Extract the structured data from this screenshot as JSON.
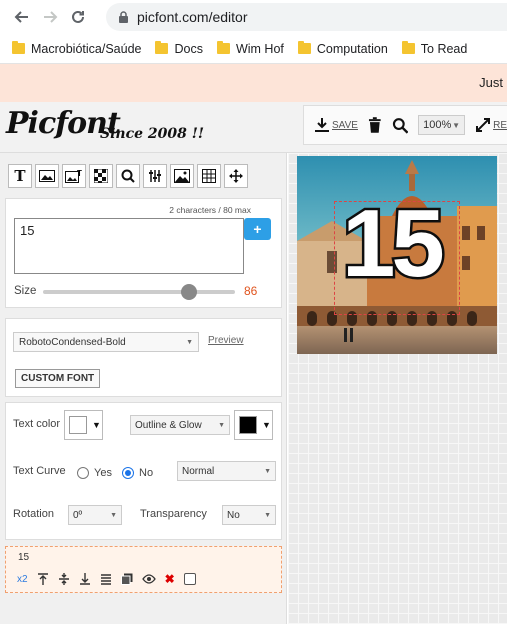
{
  "browser": {
    "url": "picfont.com/editor",
    "bookmarks": [
      "Macrobiótica/Saúde",
      "Docs",
      "Wim Hof",
      "Computation",
      "To Read"
    ]
  },
  "banner": {
    "text": "Just"
  },
  "app": {
    "logo": "Picfont",
    "since": "Since 2008 !!",
    "toolbar": {
      "save_label": "SAVE",
      "zoom": "100%",
      "re_label": "RE"
    }
  },
  "text_panel": {
    "char_count": "2 characters / 80 max",
    "text_value": "15",
    "plus_label": "+",
    "size_label": "Size",
    "size_value": "86",
    "size_fraction": 0.76
  },
  "font_panel": {
    "font": "RobotoCondensed-Bold",
    "preview_label": "Preview",
    "custom_font_label": "CUSTOM FONT"
  },
  "style_panel": {
    "text_color_label": "Text color",
    "text_color": "#ffffff",
    "effect": "Outline & Glow",
    "effect_color": "#000000",
    "curve_label": "Text Curve",
    "yes_label": "Yes",
    "no_label": "No",
    "curve_selected": "No",
    "curve_mode": "Normal",
    "rotation_label": "Rotation",
    "rotation": "0º",
    "transparency_label": "Transparency",
    "transparency": "No"
  },
  "layer": {
    "name": "15",
    "x2_label": "x2"
  },
  "canvas": {
    "overlay_text": "15"
  },
  "colors": {
    "accent": "#2d9fe6",
    "size_value": "#e0541e",
    "banner_bg": "#fde4d8"
  }
}
